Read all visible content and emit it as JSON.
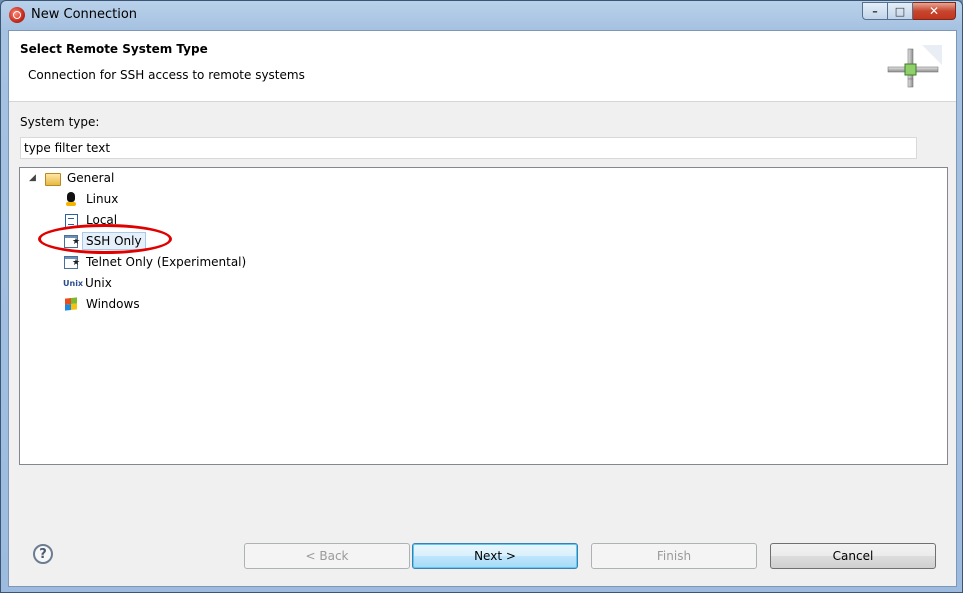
{
  "window": {
    "title": "New Connection",
    "controls": {
      "minimize": "–",
      "maximize": "□",
      "close": "✕"
    }
  },
  "banner": {
    "title": "Select Remote System Type",
    "description": "Connection for SSH access to remote systems",
    "icon": "network-connection-icon"
  },
  "filter": {
    "label": "System type:",
    "value": "type filter text"
  },
  "tree": {
    "root": {
      "label": "General",
      "icon": "folder-icon",
      "expanded": true
    },
    "items": [
      {
        "label": "Linux",
        "icon": "linux-icon"
      },
      {
        "label": "Local",
        "icon": "local-icon"
      },
      {
        "label": "SSH Only",
        "icon": "terminal-icon",
        "selected": true
      },
      {
        "label": "Telnet Only (Experimental)",
        "icon": "terminal-icon"
      },
      {
        "label": "Unix",
        "icon": "unix-icon",
        "icon_text": "Unix"
      },
      {
        "label": "Windows",
        "icon": "windows-icon"
      }
    ]
  },
  "annotation": {
    "color": "#e00000"
  },
  "buttons": {
    "help": "?",
    "back": "< Back",
    "next": "Next >",
    "finish": "Finish",
    "cancel": "Cancel"
  }
}
